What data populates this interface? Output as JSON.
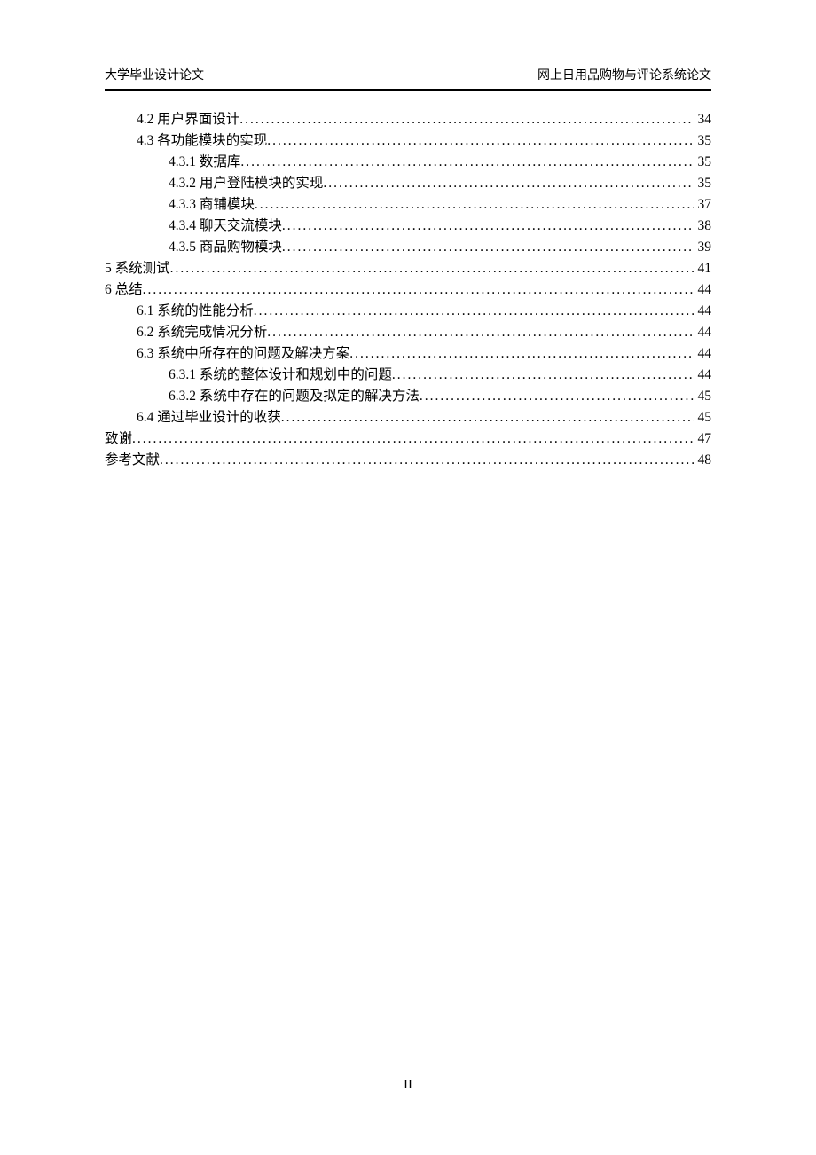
{
  "header": {
    "left": "大学毕业设计论文",
    "right": "网上日用品购物与评论系统论文"
  },
  "toc": [
    {
      "level": 1,
      "label": "4.2 用户界面设计",
      "page": "34"
    },
    {
      "level": 1,
      "label": "4.3 各功能模块的实现",
      "page": "35"
    },
    {
      "level": 2,
      "label": "4.3.1 数据库",
      "page": "35"
    },
    {
      "level": 2,
      "label": "4.3.2 用户登陆模块的实现",
      "page": "35"
    },
    {
      "level": 2,
      "label": "4.3.3 商铺模块",
      "page": "37"
    },
    {
      "level": 2,
      "label": "4.3.4 聊天交流模块",
      "page": "38"
    },
    {
      "level": 2,
      "label": "4.3.5 商品购物模块",
      "page": "39"
    },
    {
      "level": 0,
      "label": "5  系统测试",
      "page": "41"
    },
    {
      "level": 0,
      "label": "6  总结",
      "page": "44"
    },
    {
      "level": 1,
      "label": "6.1 系统的性能分析",
      "page": "44"
    },
    {
      "level": 1,
      "label": "6.2 系统完成情况分析",
      "page": "44"
    },
    {
      "level": 1,
      "label": "6.3 系统中所存在的问题及解决方案",
      "page": "44"
    },
    {
      "level": 2,
      "label": "6.3.1 系统的整体设计和规划中的问题",
      "page": "44"
    },
    {
      "level": 2,
      "label": "6.3.2 系统中存在的问题及拟定的解决方法",
      "page": "45"
    },
    {
      "level": 1,
      "label": "6.4 通过毕业设计的收获",
      "page": "45"
    },
    {
      "level": 0,
      "label": "致谢",
      "page": "47"
    },
    {
      "level": 0,
      "label": "参考文献",
      "page": "48"
    }
  ],
  "page_number": "II"
}
